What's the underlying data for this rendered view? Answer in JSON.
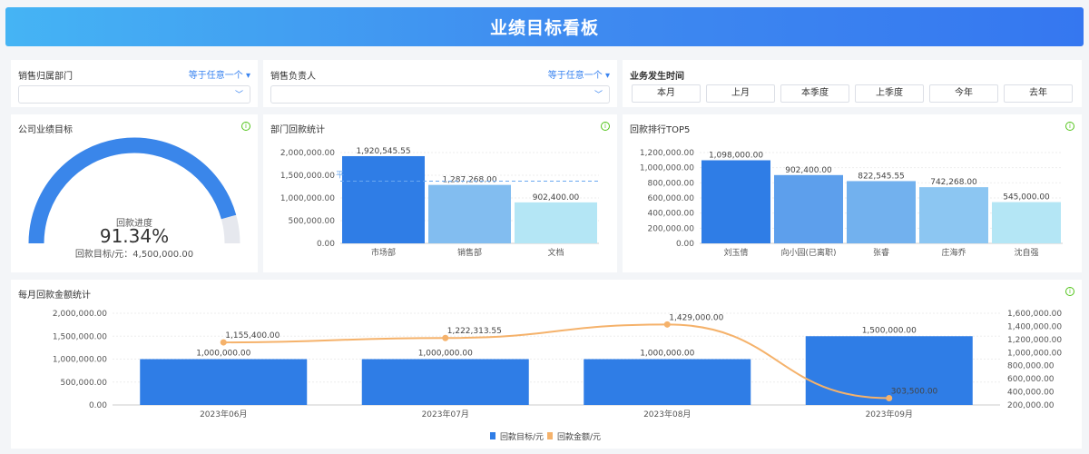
{
  "header": {
    "title": "业绩目标看板"
  },
  "filters": {
    "dept": {
      "label": "销售归属部门",
      "operator": "等于任意一个",
      "value": ""
    },
    "owner": {
      "label": "销售负责人",
      "operator": "等于任意一个",
      "value": ""
    },
    "time": {
      "label": "业务发生时间",
      "buttons": [
        "本月",
        "上月",
        "本季度",
        "上季度",
        "今年",
        "去年"
      ]
    }
  },
  "gauge": {
    "title": "公司业绩目标",
    "label": "回款进度",
    "value_text": "91.34%",
    "progress": 0.9134,
    "target_text": "回款目标/元：4,500,000.00",
    "colors": {
      "fill": "#3a86ea",
      "track": "#e6e8ee"
    }
  },
  "chart_data": [
    {
      "type": "bar",
      "title": "部门回款统计",
      "categories": [
        "市场部",
        "销售部",
        "文档"
      ],
      "values": [
        1920545.55,
        1287268.0,
        902400.0
      ],
      "value_labels": [
        "1,920,545.55",
        "1,287,268.00",
        "902,400.00"
      ],
      "ylim": [
        0,
        2000000
      ],
      "yticks": [
        "0.00",
        "500,000.00",
        "1,000,000.00",
        "1,500,000.00",
        "2,000,000.00"
      ],
      "average_line": {
        "label": "平",
        "value": 1370071.18
      },
      "colors": [
        "#2f7de6",
        "#82bdf0",
        "#b4e6f5"
      ],
      "grid": true
    },
    {
      "type": "bar",
      "title": "回款排行TOP5",
      "categories": [
        "刘玉倩",
        "向小园(已离职)",
        "张睿",
        "庄海乔",
        "沈自强"
      ],
      "values": [
        1098000,
        902400,
        822545.55,
        742268,
        545000
      ],
      "value_labels": [
        "1,098,000.00",
        "902,400.00",
        "822,545.55",
        "742,268.00",
        "545,000.00"
      ],
      "ylim": [
        0,
        1200000
      ],
      "yticks": [
        "0.00",
        "200,000.00",
        "400,000.00",
        "600,000.00",
        "800,000.00",
        "1,000,000.00",
        "1,200,000.00"
      ],
      "colors": [
        "#2f7de6",
        "#5d9fec",
        "#72b1ee",
        "#8cc6f2",
        "#b4e6f5"
      ],
      "grid": true
    },
    {
      "type": "bar+line",
      "title": "每月回款金额统计",
      "categories": [
        "2023年06月",
        "2023年07月",
        "2023年08月",
        "2023年09月"
      ],
      "series": [
        {
          "name": "回款目标/元",
          "type": "bar",
          "axis": "left",
          "values": [
            1000000,
            1000000,
            1000000,
            1500000
          ],
          "value_labels": [
            "1,000,000.00",
            "1,000,000.00",
            "1,000,000.00",
            "1,500,000.00"
          ],
          "color": "#2f7de6"
        },
        {
          "name": "回款金额/元",
          "type": "line",
          "axis": "right",
          "values": [
            1155400,
            1222313.55,
            1429000,
            303500
          ],
          "value_labels": [
            "1,155,400.00",
            "1,222,313.55",
            "1,429,000.00",
            "303,500.00"
          ],
          "color": "#f5b26b"
        }
      ],
      "ylim_left": [
        0,
        2000000
      ],
      "yticks_left": [
        "0.00",
        "500,000.00",
        "1,000,000.00",
        "1,500,000.00",
        "2,000,000.00"
      ],
      "ylim_right": [
        200000,
        1600000
      ],
      "yticks_right": [
        "200,000.00",
        "400,000.00",
        "600,000.00",
        "800,000.00",
        "1,000,000.00",
        "1,200,000.00",
        "1,400,000.00",
        "1,600,000.00"
      ],
      "legend": "bottom",
      "grid": true
    }
  ]
}
